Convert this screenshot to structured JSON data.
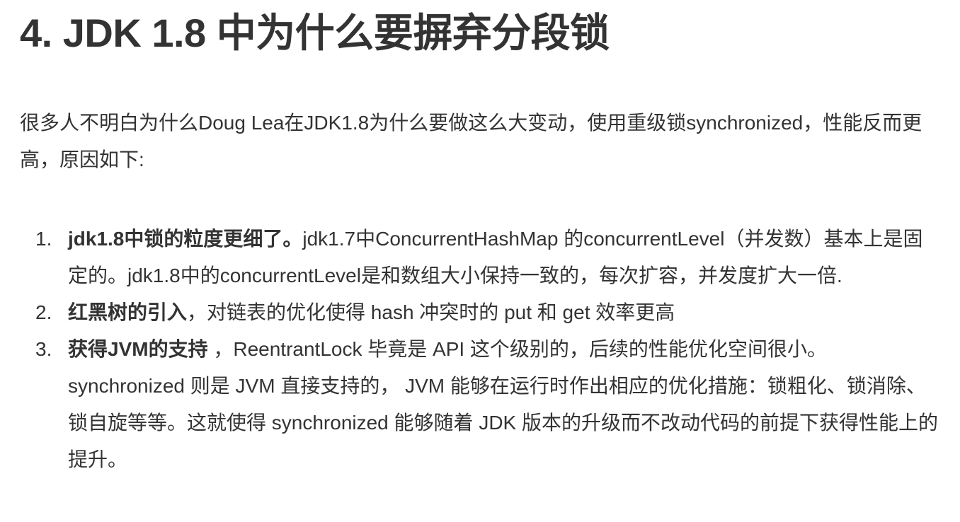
{
  "heading": "4. JDK 1.8 中为什么要摒弃分段锁",
  "intro": "很多人不明白为什么Doug Lea在JDK1.8为什么要做这么大变动，使用重级锁synchronized，性能反而更高，原因如下:",
  "items": [
    {
      "number": "1.",
      "bold": "jdk1.8中锁的粒度更细了。",
      "text": "jdk1.7中ConcurrentHashMap 的concurrentLevel（并发数）基本上是固定的。jdk1.8中的concurrentLevel是和数组大小保持一致的，每次扩容，并发度扩大一倍."
    },
    {
      "number": "2.",
      "bold": "红黑树的引入",
      "text": "，对链表的优化使得 hash 冲突时的 put 和 get 效率更高"
    },
    {
      "number": "3.",
      "bold": "获得JVM的支持",
      "text": " ，ReentrantLock 毕竟是 API 这个级别的，后续的性能优化空间很小。 synchronized 则是 JVM 直接支持的， JVM 能够在运行时作出相应的优化措施：锁粗化、锁消除、锁自旋等等。这就使得 synchronized 能够随着 JDK 版本的升级而不改动代码的前提下获得性能上的提升。"
    }
  ]
}
